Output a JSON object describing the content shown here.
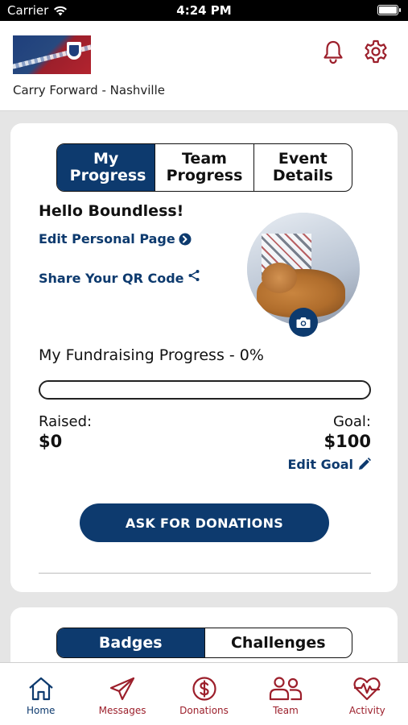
{
  "status_bar": {
    "carrier": "Carrier",
    "time": "4:24 PM"
  },
  "header": {
    "chapter_name": "Carry Forward - Nashville",
    "icons": [
      "bell-icon",
      "gear-icon"
    ]
  },
  "progress_tabs": [
    {
      "label": "My Progress",
      "active": true
    },
    {
      "label": "Team Progress",
      "active": false
    },
    {
      "label": "Event Details",
      "active": false
    }
  ],
  "profile": {
    "greeting": "Hello Boundless!",
    "edit_page_link": "Edit Personal Page",
    "share_qr_link": "Share Your QR Code"
  },
  "fundraising": {
    "title": "My Fundraising Progress - 0%",
    "percent": 0,
    "raised_label": "Raised:",
    "raised_value": "$0",
    "goal_label": "Goal:",
    "goal_value": "$100",
    "edit_goal_label": "Edit Goal",
    "ask_button": "ASK FOR DONATIONS"
  },
  "badge_tabs": [
    {
      "label": "Badges",
      "active": true
    },
    {
      "label": "Challenges",
      "active": false
    }
  ],
  "tabbar": [
    {
      "label": "Home",
      "icon": "home-icon",
      "active": true
    },
    {
      "label": "Messages",
      "icon": "paper-plane-icon",
      "active": false
    },
    {
      "label": "Donations",
      "icon": "dollar-circle-icon",
      "active": false
    },
    {
      "label": "Team",
      "icon": "team-icon",
      "active": false
    },
    {
      "label": "Activity",
      "icon": "heart-pulse-icon",
      "active": false
    }
  ],
  "colors": {
    "primary": "#0d3a6e",
    "accent": "#9c1f2b",
    "background": "#e5e5e5"
  }
}
